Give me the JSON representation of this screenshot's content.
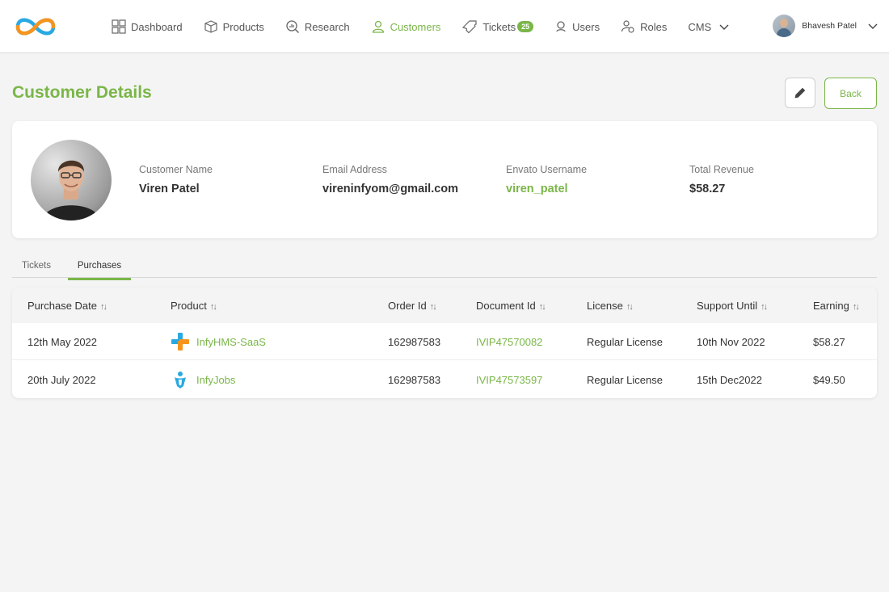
{
  "nav": {
    "items": [
      {
        "label": "Dashboard",
        "icon": "dashboard-icon"
      },
      {
        "label": "Products",
        "icon": "box-icon"
      },
      {
        "label": "Research",
        "icon": "research-icon"
      },
      {
        "label": "Customers",
        "icon": "user-icon",
        "active": true
      },
      {
        "label": "Tickets",
        "icon": "ticket-icon",
        "badge": "25"
      },
      {
        "label": "Users",
        "icon": "users-icon"
      },
      {
        "label": "Roles",
        "icon": "roles-icon"
      },
      {
        "label": "CMS",
        "icon": "chevron-down-icon"
      }
    ],
    "user_name": "Bhavesh Patel"
  },
  "page": {
    "title": "Customer Details",
    "back_label": "Back"
  },
  "profile": {
    "name_label": "Customer Name",
    "name": "Viren Patel",
    "email_label": "Email Address",
    "email": "vireninfyom@gmail.com",
    "username_label": "Envato Username",
    "username": "viren_patel",
    "revenue_label": "Total Revenue",
    "revenue": "$58.27"
  },
  "tabs": {
    "tickets": "Tickets",
    "purchases": "Purchases"
  },
  "table": {
    "headers": {
      "purchase_date": "Purchase Date",
      "product": "Product",
      "order_id": "Order Id",
      "document_id": "Document Id",
      "license": "License",
      "support_until": "Support Until",
      "earning": "Earning"
    },
    "sort_glyph": "↑↓",
    "rows": [
      {
        "purchase_date": "12th May 2022",
        "product": "InfyHMS-SaaS",
        "order_id": "162987583",
        "document_id": "IVIP47570082",
        "license": "Regular License",
        "support_until": "10th Nov 2022",
        "earning": "$58.27"
      },
      {
        "purchase_date": "20th July 2022",
        "product": "InfyJobs",
        "order_id": "162987583",
        "document_id": "IVIP47573597",
        "license": "Regular License",
        "support_until": "15th Dec2022",
        "earning": "$49.50"
      }
    ]
  },
  "colors": {
    "accent": "#7ab648",
    "background": "#f4f4f4"
  }
}
